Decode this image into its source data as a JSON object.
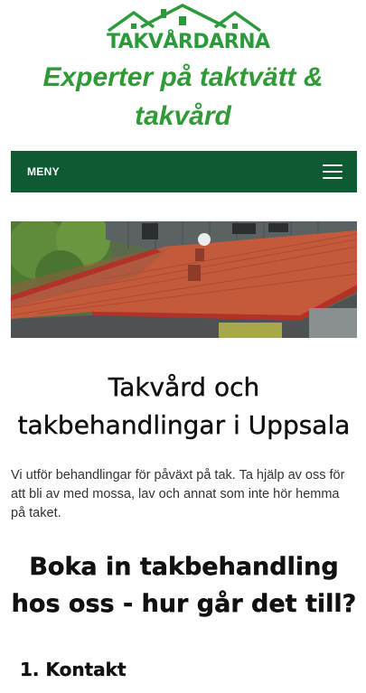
{
  "header": {
    "logo_text": "TAKVÅRDARNA",
    "tagline": "Experter på taktvätt & takvård"
  },
  "nav": {
    "menu_label": "MENY"
  },
  "colors": {
    "brand_green": "#2f9a36",
    "nav_green": "#0e5a33"
  },
  "main": {
    "title": "Takvård och takbehandlingar i Uppsala",
    "intro": "Vi utför behandlingar för påväxt på tak. Ta hjälp av oss för att bli av med mossa, lav och annat som inte hör hemma på taket.",
    "booking_heading": "Boka in takbehandling hos oss - hur går det till?",
    "step_1": "1. Kontakt"
  }
}
